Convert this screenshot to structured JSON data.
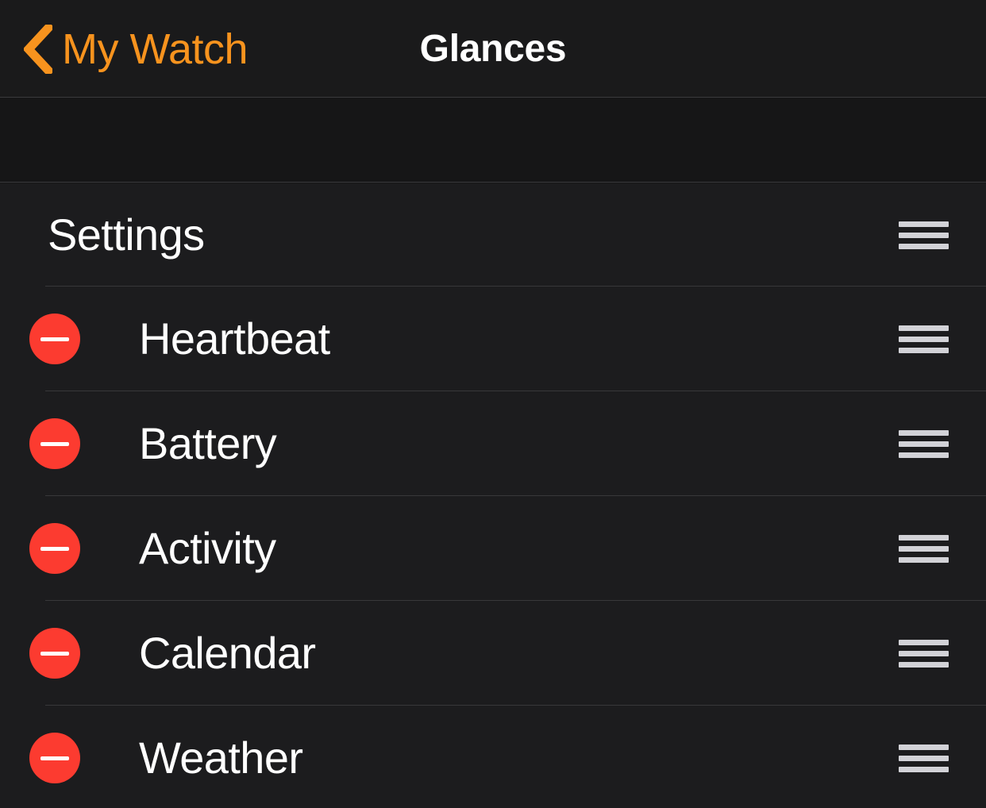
{
  "window": {
    "app": "Apple Watch",
    "background_color": "#161617"
  },
  "navbar": {
    "back_label": "My Watch",
    "back_icon": "chevron-left-icon",
    "title": "Glances",
    "accent_color": "#f7931e",
    "title_color": "#ffffff",
    "background_color": "#1a1a1b"
  },
  "list": {
    "background_color": "#1c1c1e",
    "separator_color": "#38383a",
    "delete_color": "#fc3b30",
    "handle_color": "#d2d2d7",
    "editing": true,
    "rows": [
      {
        "label": "Settings",
        "kind": "section",
        "has_delete": false,
        "has_handle": true,
        "delete_icon": "",
        "handle_icon": "reorder-handle-icon"
      },
      {
        "label": "Heartbeat",
        "kind": "glance",
        "has_delete": true,
        "has_handle": true,
        "delete_icon": "minus-circle-icon",
        "handle_icon": "reorder-handle-icon"
      },
      {
        "label": "Battery",
        "kind": "glance",
        "has_delete": true,
        "has_handle": true,
        "delete_icon": "minus-circle-icon",
        "handle_icon": "reorder-handle-icon"
      },
      {
        "label": "Activity",
        "kind": "glance",
        "has_delete": true,
        "has_handle": true,
        "delete_icon": "minus-circle-icon",
        "handle_icon": "reorder-handle-icon"
      },
      {
        "label": "Calendar",
        "kind": "glance",
        "has_delete": true,
        "has_handle": true,
        "delete_icon": "minus-circle-icon",
        "handle_icon": "reorder-handle-icon"
      },
      {
        "label": "Weather",
        "kind": "glance",
        "has_delete": true,
        "has_handle": true,
        "delete_icon": "minus-circle-icon",
        "handle_icon": "reorder-handle-icon"
      }
    ]
  }
}
